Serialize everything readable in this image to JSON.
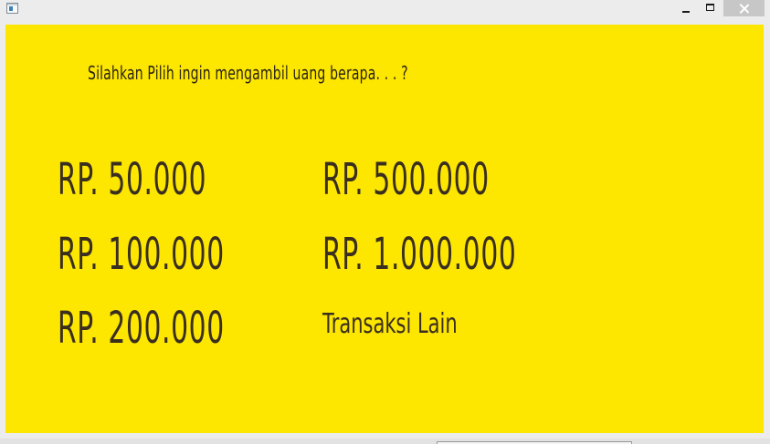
{
  "window": {
    "icons": {
      "app": "app-window-icon",
      "minimize": "minimize-icon",
      "maximize": "maximize-icon",
      "close": "close-icon"
    },
    "colors": {
      "panel_background": "#fde600",
      "text": "#3a2f1f",
      "close_button": "#c7c7c7"
    }
  },
  "panel": {
    "prompt": "Silahkan Pilih ingin mengambil uang berapa. . . ?",
    "options": {
      "left": [
        "RP. 50.000",
        "RP. 100.000",
        "RP. 200.000"
      ],
      "right": [
        "RP. 500.000",
        "RP. 1.000.000",
        "Transaksi Lain"
      ]
    }
  }
}
